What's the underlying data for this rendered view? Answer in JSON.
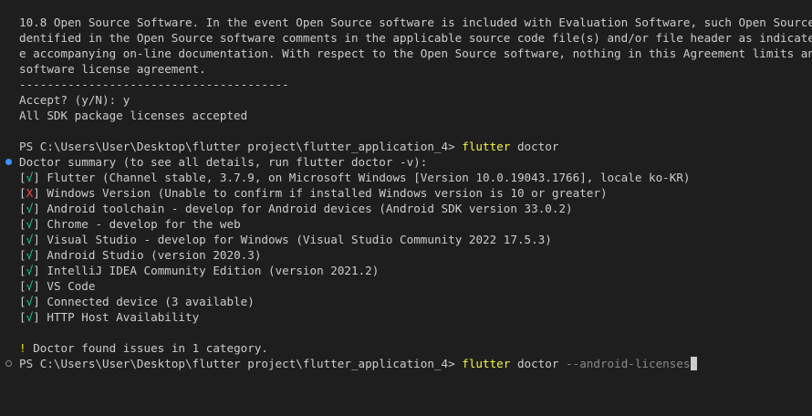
{
  "license_lines": [
    "10.8 Open Source Software. In the event Open Source software is included with Evaluation Software, such Open Source software",
    "dentified in the Open Source software comments in the applicable source code file(s) and/or file header as indicated in the",
    "e accompanying on-line documentation. With respect to the Open Source software, nothing in this Agreement limits any rights",
    "software license agreement."
  ],
  "separator": "---------------------------------------",
  "accept_prompt": "Accept? (y/N): y",
  "accepted_message": "All SDK package licenses accepted",
  "prompt_path": "PS C:\\Users\\User\\Desktop\\flutter project\\flutter_application_4>",
  "command1": {
    "cmd": "flutter",
    "arg": "doctor"
  },
  "doctor_summary": "Doctor summary (to see all details, run flutter doctor -v):",
  "checks": [
    {
      "mark": "√",
      "status": "ok",
      "text": "Flutter (Channel stable, 3.7.9, on Microsoft Windows [Version 10.0.19043.1766], locale ko-KR)"
    },
    {
      "mark": "X",
      "status": "error",
      "text": "Windows Version (Unable to confirm if installed Windows version is 10 or greater)"
    },
    {
      "mark": "√",
      "status": "ok",
      "text": "Android toolchain - develop for Android devices (Android SDK version 33.0.2)"
    },
    {
      "mark": "√",
      "status": "ok",
      "text": "Chrome - develop for the web"
    },
    {
      "mark": "√",
      "status": "ok",
      "text": "Visual Studio - develop for Windows (Visual Studio Community 2022 17.5.3)"
    },
    {
      "mark": "√",
      "status": "ok",
      "text": "Android Studio (version 2020.3)"
    },
    {
      "mark": "√",
      "status": "ok",
      "text": "IntelliJ IDEA Community Edition (version 2021.2)"
    },
    {
      "mark": "√",
      "status": "ok",
      "text": "VS Code"
    },
    {
      "mark": "√",
      "status": "ok",
      "text": "Connected device (3 available)"
    },
    {
      "mark": "√",
      "status": "ok",
      "text": "HTTP Host Availability"
    }
  ],
  "issues": {
    "mark": "!",
    "text": "Doctor found issues in 1 category."
  },
  "command2": {
    "cmd": "flutter",
    "arg": "doctor",
    "flag": "--android-licenses"
  },
  "colors": {
    "background": "#1e1e1e",
    "text": "#cccccc",
    "ok": "#23d18b",
    "error": "#f14c4c",
    "command": "#f5f543",
    "decoration_filled": "#3794ff"
  }
}
